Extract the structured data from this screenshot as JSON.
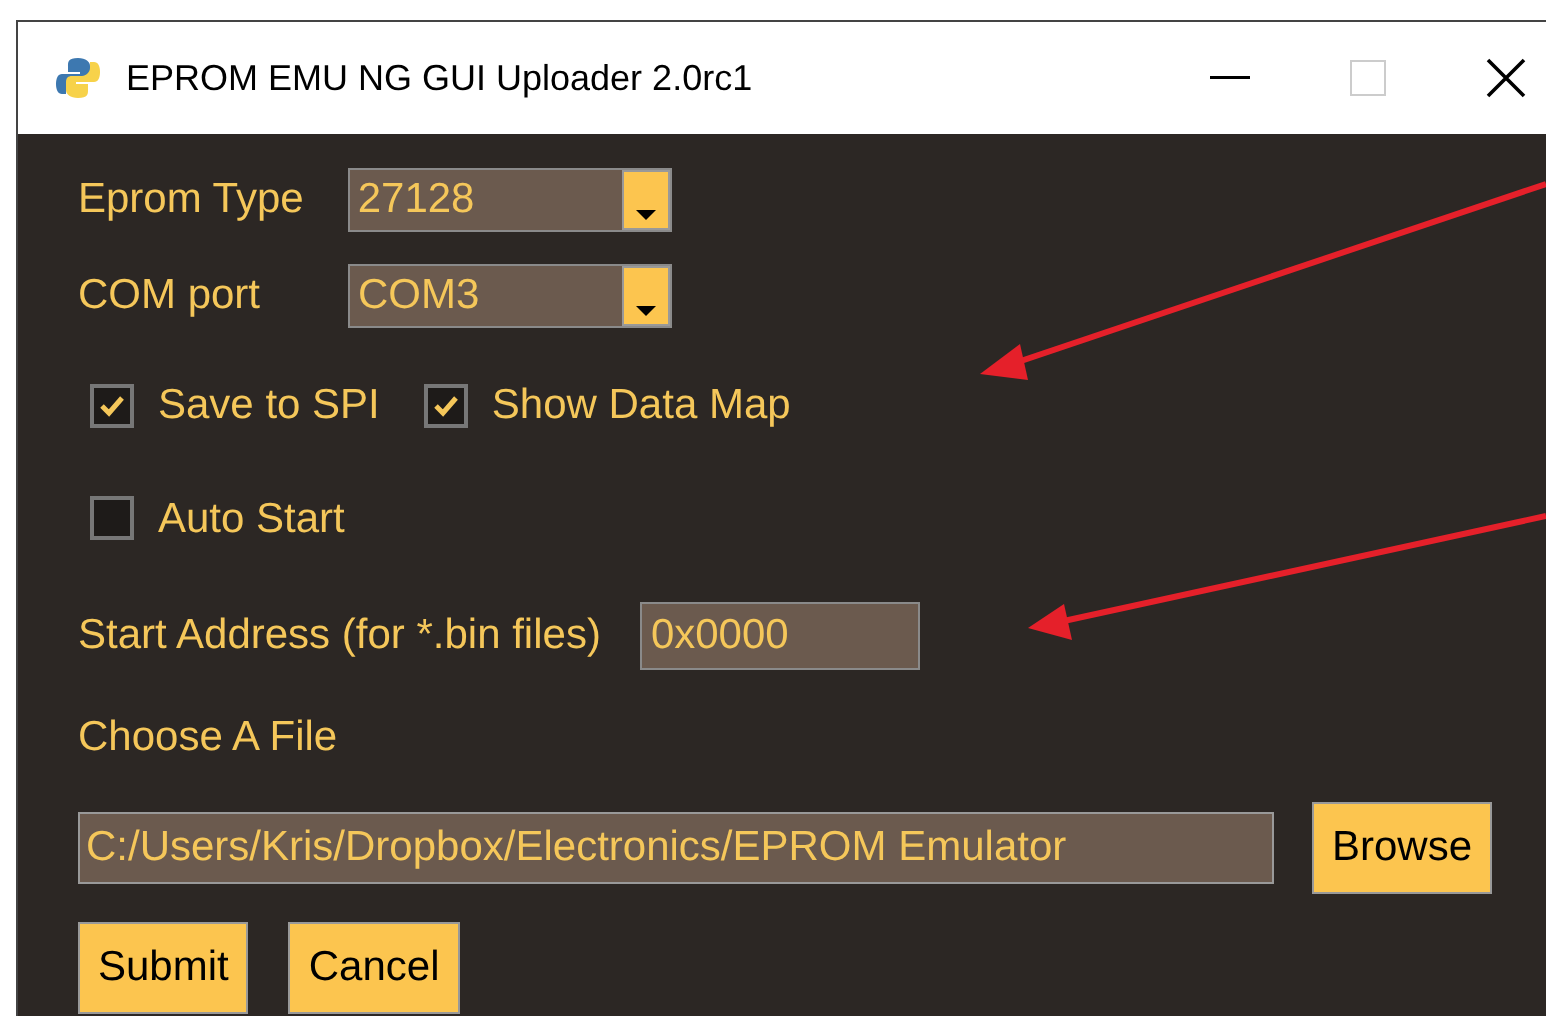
{
  "window": {
    "title": "EPROM EMU NG GUI Uploader 2.0rc1"
  },
  "eprom_type": {
    "label": "Eprom Type",
    "value": "27128"
  },
  "com_port": {
    "label": "COM port",
    "value": "COM3"
  },
  "checkboxes": [
    {
      "label": "Save to SPI",
      "checked": true
    },
    {
      "label": "Show Data Map",
      "checked": true
    },
    {
      "label": "Auto Start",
      "checked": false
    }
  ],
  "start_address": {
    "label": "Start Address (for *.bin files)",
    "value": "0x0000"
  },
  "file": {
    "label": "Choose A File",
    "value": "C:/Users/Kris/Dropbox/Electronics/EPROM Emulator",
    "browse": "Browse"
  },
  "buttons": [
    "Submit",
    "Cancel"
  ]
}
